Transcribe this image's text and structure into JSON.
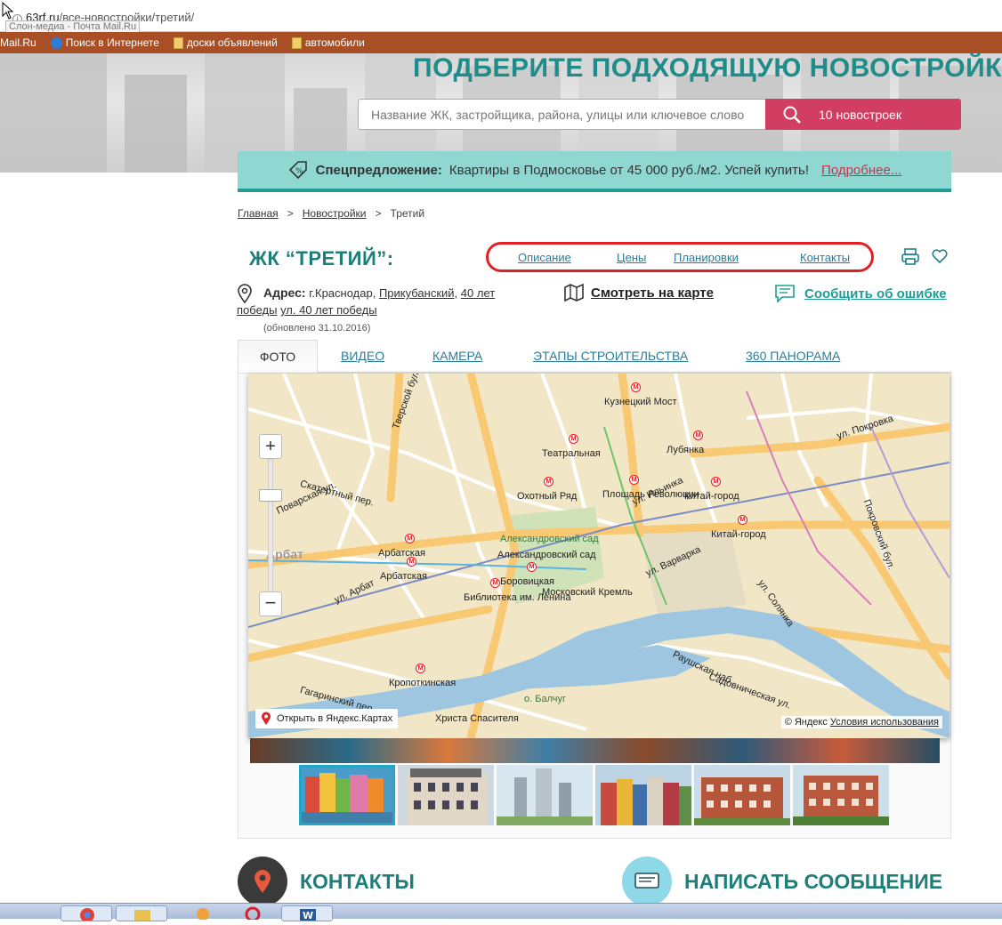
{
  "browser": {
    "url_host": "63rf.ru",
    "url_path": "/все-новостройки/третий/",
    "tooltip": "Слон-медиа - Почта Mail.Ru"
  },
  "bookmarks": [
    {
      "label": "Mail.Ru",
      "icon": "none"
    },
    {
      "label": "Поиск в Интернете",
      "icon": "search-icon"
    },
    {
      "label": "доски объявлений",
      "icon": "folder-icon"
    },
    {
      "label": "автомобили",
      "icon": "folder-icon"
    }
  ],
  "hero": {
    "title": "ПОДБЕРИТЕ ПОДХОДЯЩУЮ НОВОСТРОЙК",
    "search_placeholder": "Название ЖК, застройщика, района, улицы или ключевое слово",
    "search_button": "10 новостроек"
  },
  "special": {
    "label": "Спецпредложение:",
    "text": "Квартиры в Подмосковье от 45 000 руб./м2. Успей купить!",
    "link": "Подробнее..."
  },
  "breadcrumbs": {
    "home": "Главная",
    "sep": ">",
    "section": "Новостройки",
    "current": "Третий"
  },
  "complex": {
    "title": "ЖК “ТРЕТИЙ”:",
    "nav": [
      "Описание",
      "Цены",
      "Планировки",
      "Контакты"
    ]
  },
  "address": {
    "label": "Адрес:",
    "city": "г.Краснодар,",
    "district": "Прикубанский,",
    "street1": "40 лет победы",
    "street2": "ул. 40 лет победы",
    "updated": "(обновлено 31.10.2016)"
  },
  "links": {
    "map": "Смотреть на карте",
    "error": "Сообщить об ошибке"
  },
  "tabs": [
    "ФОТО",
    "ВИДЕО",
    "КАМЕРА",
    "ЭТАПЫ СТРОИТЕЛЬСТВА",
    "360 ПАНОРАМА"
  ],
  "map": {
    "labels": [
      "Кузнецкий Мост",
      "Лубянка",
      "Театральная",
      "Охотный Ряд",
      "Площадь Революции",
      "Китай-город",
      "Китай-город",
      "Арбатская",
      "Арбатская",
      "Александровский сад",
      "Александровский сад",
      "Боровицкая",
      "Библиотека им. Ленина",
      "Московский Кремль",
      "Кропоткинская",
      "Христа Спасителя",
      "ул. Покровка",
      "ул. Варварка",
      "ул. Солянка",
      "Раушская наб.",
      "Тверской бул.",
      "Поварская ул.",
      "ул. Арбат",
      "Арбат",
      "Садовническая ул.",
      "Покровский бул.",
      "о. Балчуг",
      "Скатертный пер.",
      "ул. Ильинка",
      "Гагаринский пер."
    ],
    "open_link": "Открыть в Яндекс.Картах",
    "copyright": "© Яндекс",
    "terms": "Условия использования",
    "zoom_in": "+",
    "zoom_out": "−"
  },
  "thumbnails": 6,
  "sections": {
    "contacts": "КОНТАКТЫ",
    "message": "НАПИСАТЬ СООБЩЕНИЕ"
  },
  "colors": {
    "accent": "#1f9d96",
    "button": "#d23e61",
    "highlight": "#e31e24"
  }
}
